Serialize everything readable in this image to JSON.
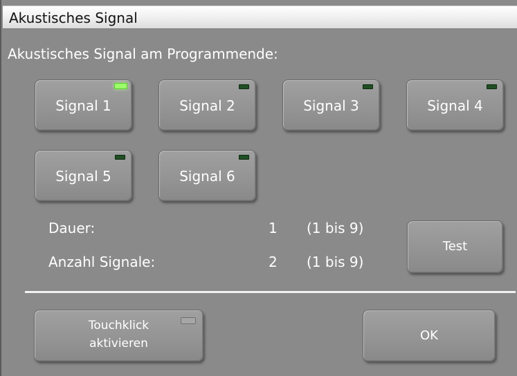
{
  "window": {
    "title": "Akustisches Signal"
  },
  "heading": "Akustisches Signal am Programmende:",
  "signals": [
    {
      "label": "Signal 1",
      "active": true
    },
    {
      "label": "Signal 2",
      "active": false
    },
    {
      "label": "Signal 3",
      "active": false
    },
    {
      "label": "Signal 4",
      "active": false
    },
    {
      "label": "Signal 5",
      "active": false
    },
    {
      "label": "Signal 6",
      "active": false
    }
  ],
  "settings": {
    "duration": {
      "label": "Dauer:",
      "value": "1",
      "range": "(1 bis 9)"
    },
    "count": {
      "label": "Anzahl Signale:",
      "value": "2",
      "range": "(1 bis 9)"
    }
  },
  "buttons": {
    "test": "Test",
    "touchklick_line1": "Touchklick",
    "touchklick_line2": "aktivieren",
    "ok": "OK"
  },
  "touchklick_enabled": false,
  "colors": {
    "background": "#8a8a8a",
    "led_on": "#9cff6a",
    "led_off": "#1f4f23"
  }
}
